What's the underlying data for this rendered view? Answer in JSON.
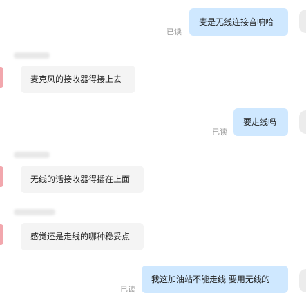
{
  "chat": {
    "read_label": "已读",
    "messages": [
      {
        "direction": "outgoing",
        "text": "麦是无线连接音响哈",
        "read": "已读"
      },
      {
        "direction": "incoming",
        "text": "麦克风的接收器得接上去"
      },
      {
        "direction": "outgoing",
        "text": "要走线吗",
        "read": "已读"
      },
      {
        "direction": "incoming",
        "text": "无线的话接收器得插在上面"
      },
      {
        "direction": "incoming",
        "text": "感觉还是走线的哪种稳妥点"
      },
      {
        "direction": "outgoing",
        "text": "我这加油站不能走线 要用无线的",
        "read": "已读"
      }
    ]
  },
  "colors": {
    "outgoing_bubble": "#cfe8ff",
    "incoming_bubble": "#f4f4f4",
    "read_text": "#9a9a9a",
    "avatar_accent": "#f2a7ad"
  }
}
